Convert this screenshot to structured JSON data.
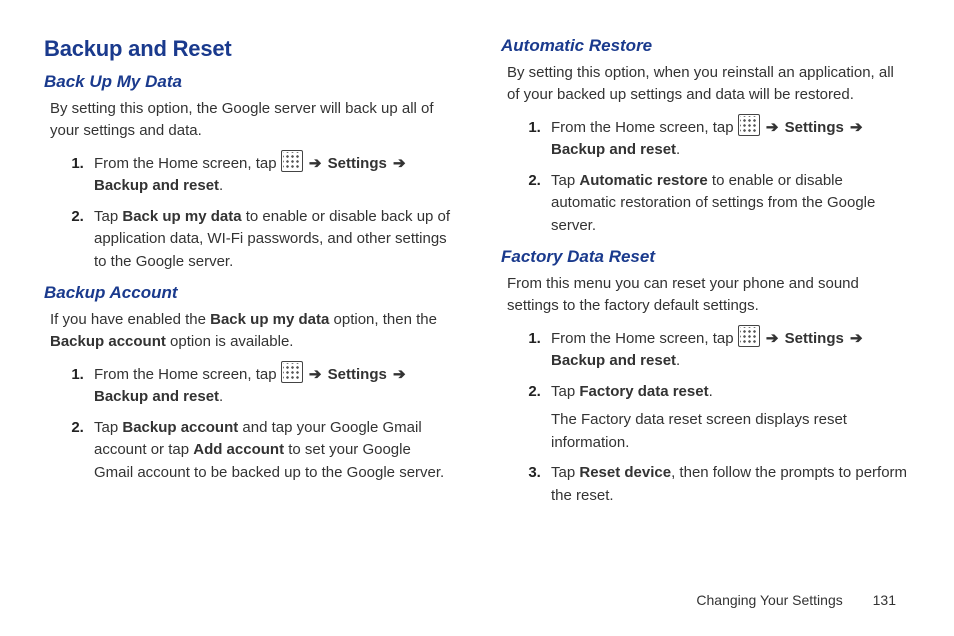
{
  "footer": {
    "chapter": "Changing Your Settings",
    "page": "131"
  },
  "left": {
    "h1": "Backup and Reset",
    "sect1": {
      "h2": "Back Up My Data",
      "p": "By setting this option, the Google server will back up all of your settings and data.",
      "step1_a": "From the Home screen, tap ",
      "step1_b": " Settings ",
      "step1_c": " Backup and reset",
      "step2_a": "Tap ",
      "step2_b": "Back up my data",
      "step2_c": " to enable or disable back up of application data, WI-Fi passwords, and other settings to the Google server."
    },
    "sect2": {
      "h2": "Backup Account",
      "p_a": "If you have enabled the ",
      "p_b": "Back up my data",
      "p_c": " option, then the ",
      "p_d": "Backup account",
      "p_e": " option is available.",
      "step1_a": "From the Home screen, tap ",
      "step1_b": " Settings ",
      "step1_c": " Backup and reset",
      "step2_a": "Tap ",
      "step2_b": "Backup account",
      "step2_c": " and tap your Google Gmail account or tap ",
      "step2_d": "Add account",
      "step2_e": " to set your Google Gmail account to be backed up to the Google server."
    }
  },
  "right": {
    "sect1": {
      "h2": "Automatic Restore",
      "p": "By setting this option, when you reinstall an application, all of your backed up settings and data will be restored.",
      "step1_a": "From the Home screen, tap ",
      "step1_b": " Settings ",
      "step1_c": " Backup and reset",
      "step2_a": "Tap ",
      "step2_b": "Automatic restore",
      "step2_c": " to enable or disable automatic restoration of settings from the Google server."
    },
    "sect2": {
      "h2": "Factory Data Reset",
      "p": "From this menu you can reset your phone and sound settings to the factory default settings.",
      "step1_a": "From the Home screen, tap ",
      "step1_b": " Settings ",
      "step1_c": " Backup and reset",
      "step2_a": "Tap ",
      "step2_b": "Factory data reset",
      "step2_sub": "The Factory data reset screen displays reset information.",
      "step3_a": "Tap ",
      "step3_b": "Reset device",
      "step3_c": ", then follow the prompts to perform the reset."
    }
  },
  "glyph": {
    "arrow": "➔",
    "period": "."
  }
}
